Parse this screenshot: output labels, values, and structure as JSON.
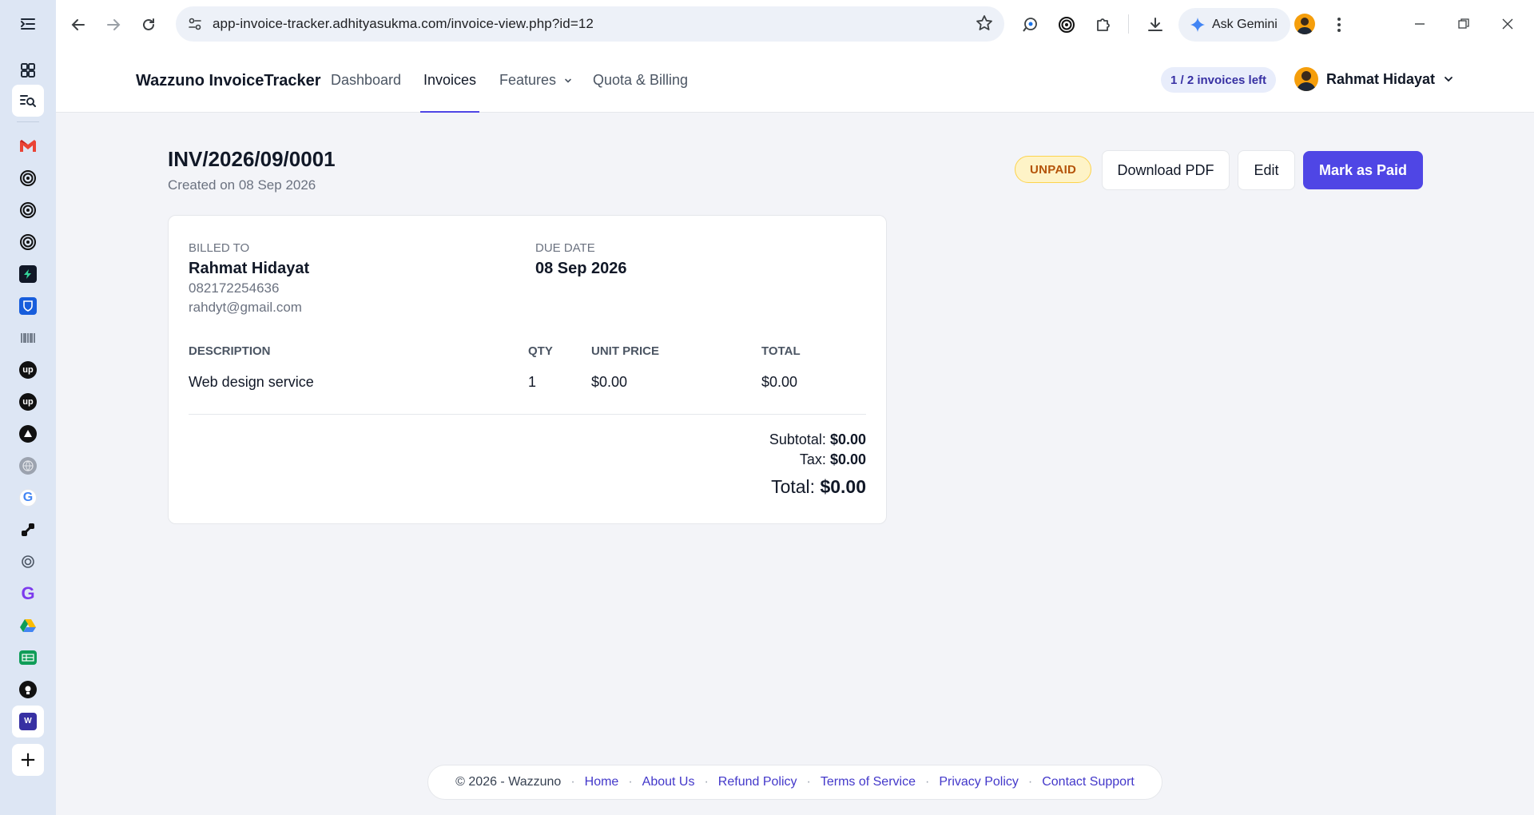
{
  "browser": {
    "url": "app-invoice-tracker.adhityasukma.com/invoice-view.php?id=12",
    "gemini_label": "Ask Gemini"
  },
  "sidebar_apps": [
    {
      "name": "gmail-icon",
      "color": "#ea4335"
    },
    {
      "name": "target-icon",
      "color": "#111111"
    },
    {
      "name": "target-icon",
      "color": "#111111"
    },
    {
      "name": "target-icon",
      "color": "#111111"
    },
    {
      "name": "bolt-icon",
      "color": "#10b981"
    },
    {
      "name": "bitwarden-icon",
      "color": "#175ddc"
    },
    {
      "name": "barcode-icon",
      "color": "#6b7280"
    },
    {
      "name": "upwork-icon",
      "color": "#111111"
    },
    {
      "name": "upwork-icon",
      "color": "#111111"
    },
    {
      "name": "triangle-icon",
      "color": "#111111"
    },
    {
      "name": "globe-icon",
      "color": "#9ca3af"
    },
    {
      "name": "google-icon",
      "color": "#4285f4"
    },
    {
      "name": "link-icon",
      "color": "#111111"
    },
    {
      "name": "openai-icon",
      "color": "#6b7280"
    },
    {
      "name": "g-brand-icon",
      "color": "#7c3aed"
    },
    {
      "name": "drive-icon",
      "color": "#0f9d58"
    },
    {
      "name": "sheets-icon",
      "color": "#0f9d58"
    },
    {
      "name": "github-icon",
      "color": "#111111"
    },
    {
      "name": "wazzuno-icon",
      "color": "#3730a3"
    }
  ],
  "app": {
    "brand": "Wazzuno InvoiceTracker",
    "nav": {
      "dashboard": "Dashboard",
      "invoices": "Invoices",
      "features": "Features",
      "quota": "Quota & Billing"
    },
    "quota_badge": "1 / 2 invoices left",
    "user_name": "Rahmat Hidayat"
  },
  "invoice": {
    "number": "INV/2026/09/0001",
    "created": "Created on 08 Sep 2026",
    "status": "UNPAID",
    "actions": {
      "download": "Download PDF",
      "edit": "Edit",
      "mark_paid": "Mark as Paid"
    },
    "billed_to_label": "BILLED TO",
    "client_name": "Rahmat Hidayat",
    "client_phone": "082172254636",
    "client_email": "rahdyt@gmail.com",
    "due_label": "DUE DATE",
    "due_date": "08 Sep 2026",
    "columns": {
      "description": "DESCRIPTION",
      "qty": "QTY",
      "unit_price": "UNIT PRICE",
      "total": "TOTAL"
    },
    "items": [
      {
        "description": "Web design service",
        "qty": "1",
        "unit_price": "$0.00",
        "total": "$0.00"
      }
    ],
    "summary": {
      "subtotal_label": "Subtotal:",
      "subtotal": "$0.00",
      "tax_label": "Tax:",
      "tax": "$0.00",
      "total_label": "Total:",
      "total": "$0.00"
    }
  },
  "footer": {
    "copyright": "© 2026 - Wazzuno",
    "links": {
      "home": "Home",
      "about": "About Us",
      "refund": "Refund Policy",
      "terms": "Terms of Service",
      "privacy": "Privacy Policy",
      "support": "Contact Support"
    },
    "separator": "·"
  }
}
